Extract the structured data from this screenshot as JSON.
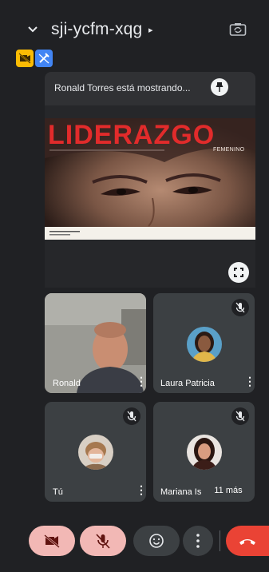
{
  "header": {
    "meeting_code": "sji-ycfm-xqg",
    "expand_arrow": "▸"
  },
  "presentation": {
    "banner_text": "Ronald Torres está mostrando...",
    "slide": {
      "title": "LIDERAZGO",
      "subtitle": "FEMENINO"
    }
  },
  "participants": [
    {
      "name": "Ronald",
      "muted": false
    },
    {
      "name": "Laura Patricia",
      "muted": true
    },
    {
      "name": "Tú",
      "muted": true
    },
    {
      "name": "Mariana Is",
      "muted": true
    }
  ],
  "more_participants_label": "11 más",
  "colors": {
    "background": "#202124",
    "accent_red": "#ea4335",
    "muted_pink": "#f2b8b5",
    "yellow_badge": "#fbbc04",
    "blue_badge": "#4285f4"
  }
}
